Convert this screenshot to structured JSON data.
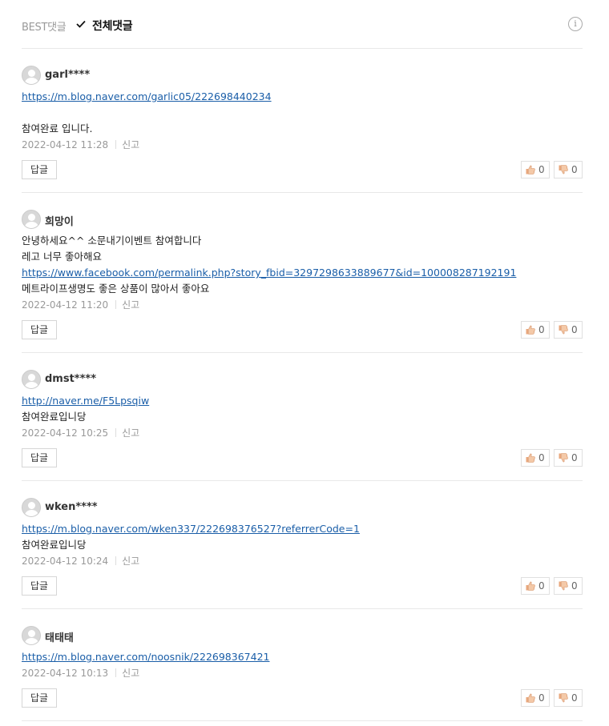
{
  "sort": {
    "best_label": "BEST댓글",
    "all_label": "전체댓글",
    "info_glyph": "i"
  },
  "reply_label": "답글",
  "report_label": "신고",
  "comments": [
    {
      "nick": "garl****",
      "lines": [
        {
          "text": "https://m.blog.naver.com/garlic05/222698440234",
          "link": true
        },
        {
          "text": "",
          "link": false
        },
        {
          "text": "참여완료 입니다.",
          "link": false
        }
      ],
      "date": "2022-04-12 11:28",
      "likes": "0",
      "dislikes": "0"
    },
    {
      "nick": "희망이",
      "lines": [
        {
          "text": "안녕하세요^^ 소문내기이벤트 참여합니다",
          "link": false
        },
        {
          "text": "레고 너무 좋아해요",
          "link": false
        },
        {
          "text": "https://www.facebook.com/permalink.php?story_fbid=3297298633889677&id=100008287192191",
          "link": true
        },
        {
          "text": "메트라이프생명도 좋은 상품이 많아서 좋아요",
          "link": false
        }
      ],
      "date": "2022-04-12 11:20",
      "likes": "0",
      "dislikes": "0"
    },
    {
      "nick": "dmst****",
      "lines": [
        {
          "text": "http://naver.me/F5Lpsqiw",
          "link": true
        },
        {
          "text": "참여완료입니당",
          "link": false
        }
      ],
      "date": "2022-04-12 10:25",
      "likes": "0",
      "dislikes": "0"
    },
    {
      "nick": "wken****",
      "lines": [
        {
          "text": "https://m.blog.naver.com/wken337/222698376527?referrerCode=1",
          "link": true
        },
        {
          "text": "참여완료입니당",
          "link": false
        }
      ],
      "date": "2022-04-12 10:24",
      "likes": "0",
      "dislikes": "0"
    },
    {
      "nick": "태태태",
      "lines": [
        {
          "text": "https://m.blog.naver.com/noosnik/222698367421",
          "link": true
        }
      ],
      "date": "2022-04-12 10:13",
      "likes": "0",
      "dislikes": "0"
    }
  ]
}
